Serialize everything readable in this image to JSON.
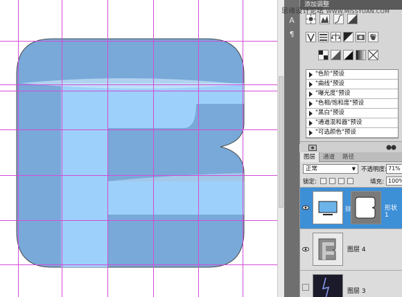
{
  "watermark": {
    "text": "思缘设计论坛",
    "url": "WWW.MISSYUAN.COM"
  },
  "adjustments": {
    "header": "添加调整",
    "presets": [
      "\"色阶\"预设",
      "\"曲线\"预设",
      "\"曝光度\"预设",
      "\"色相/饱和度\"预设",
      "\"黑白\"预设",
      "\"通道混和器\"预设",
      "\"可选颜色\"预设"
    ]
  },
  "layers": {
    "tabs": [
      "图层",
      "通道",
      "路径"
    ],
    "blend_mode": "正常",
    "opacity_label": "不透明度:",
    "opacity_value": "71%",
    "lock_label": "锁定:",
    "fill_label": "填充:",
    "fill_value": "100%",
    "items": [
      {
        "name": "形状 1",
        "selected": true
      },
      {
        "name": "图层 4",
        "selected": false
      },
      {
        "name": "图层 3",
        "selected": false
      }
    ]
  },
  "colors": {
    "shape_outer": "#7da8d8",
    "shape_inner": "#9bcff8",
    "guides": "#d24cd6",
    "selection": "#3d8fd6"
  }
}
